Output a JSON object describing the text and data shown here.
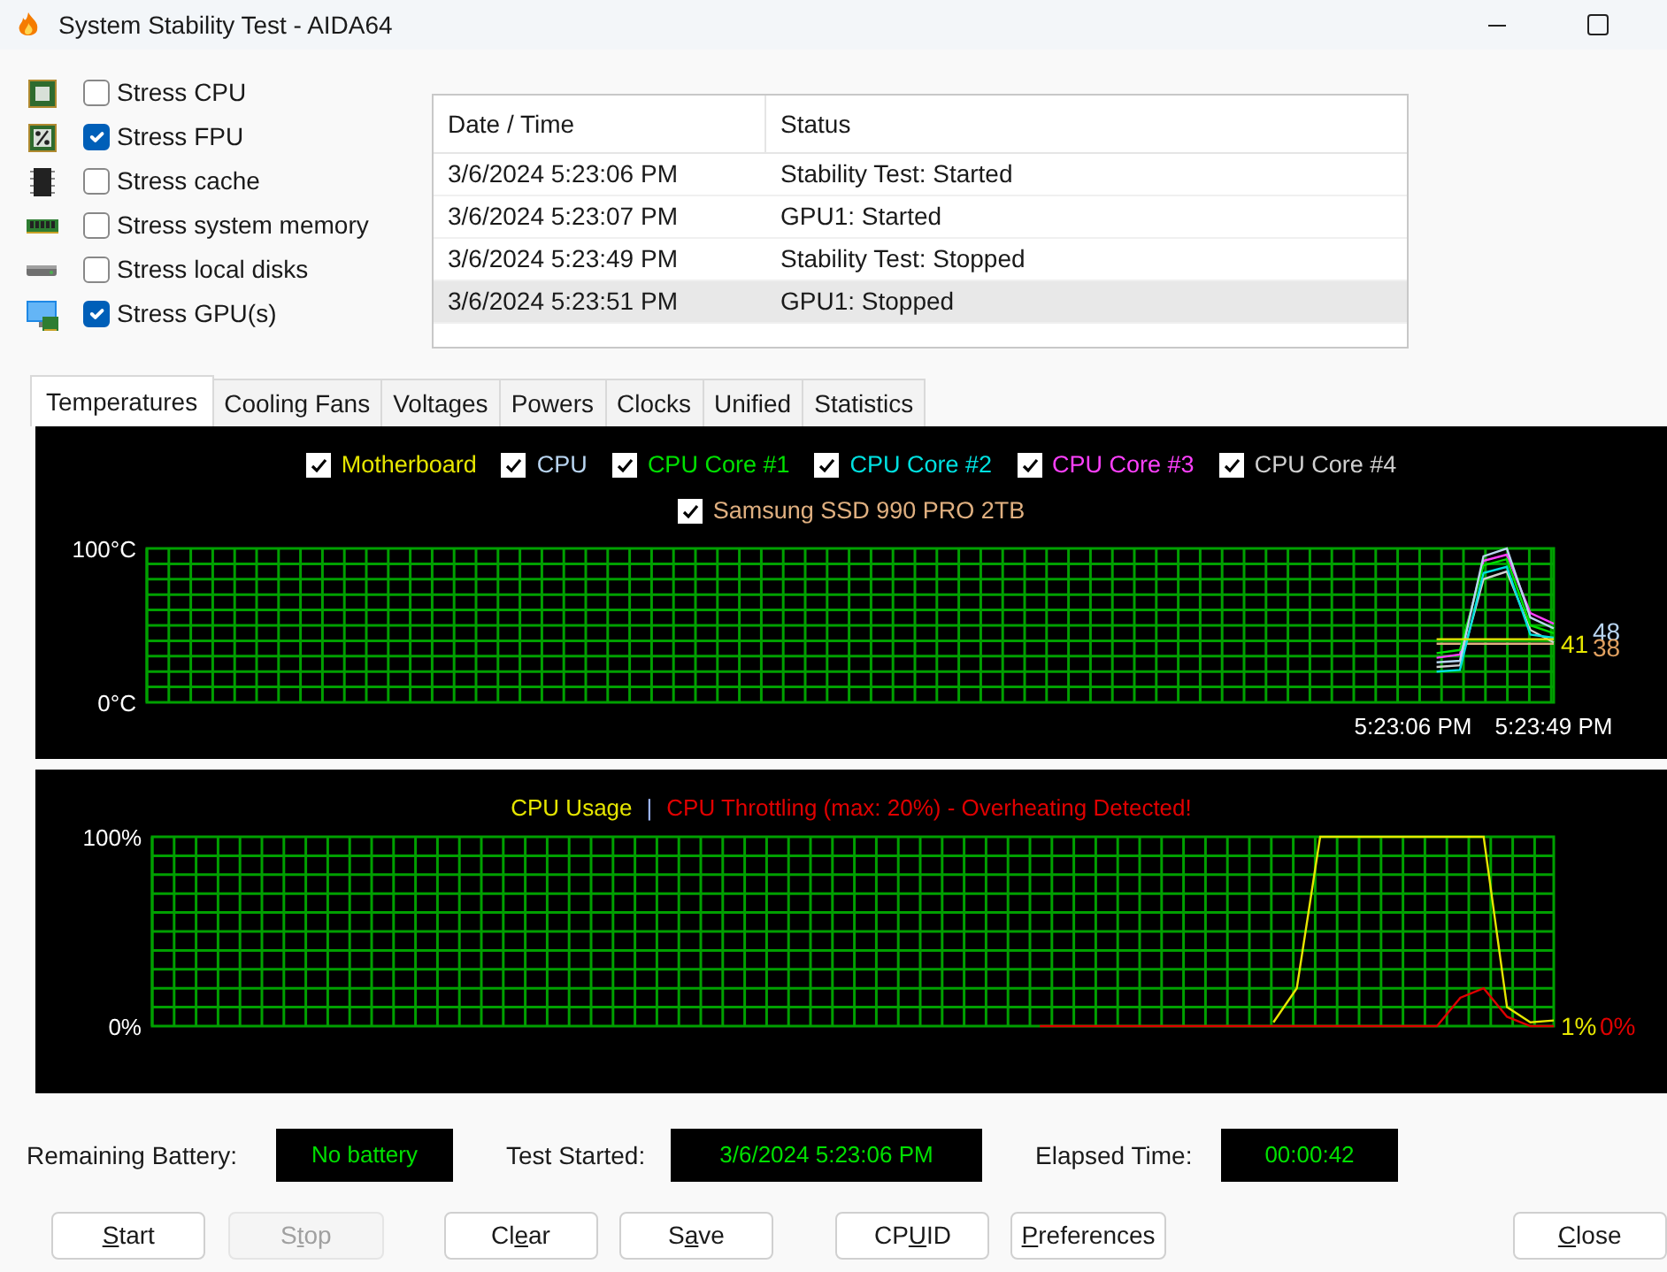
{
  "window": {
    "title": "System Stability Test - AIDA64"
  },
  "stress_options": [
    {
      "label": "Stress CPU",
      "checked": false,
      "kind": "cpu"
    },
    {
      "label": "Stress FPU",
      "checked": true,
      "kind": "fpu"
    },
    {
      "label": "Stress cache",
      "checked": false,
      "kind": "cache"
    },
    {
      "label": "Stress system memory",
      "checked": false,
      "kind": "memory"
    },
    {
      "label": "Stress local disks",
      "checked": false,
      "kind": "disk"
    },
    {
      "label": "Stress GPU(s)",
      "checked": true,
      "kind": "gpu"
    }
  ],
  "log": {
    "columns": [
      "Date / Time",
      "Status"
    ],
    "rows": [
      {
        "cells": [
          "3/6/2024 5:23:06 PM",
          "Stability Test: Started"
        ],
        "selected": false
      },
      {
        "cells": [
          "3/6/2024 5:23:07 PM",
          "GPU1: Started"
        ],
        "selected": false
      },
      {
        "cells": [
          "3/6/2024 5:23:49 PM",
          "Stability Test: Stopped"
        ],
        "selected": false
      },
      {
        "cells": [
          "3/6/2024 5:23:51 PM",
          "GPU1: Stopped"
        ],
        "selected": true
      }
    ]
  },
  "tabs": [
    {
      "label": "Temperatures",
      "selected": true
    },
    {
      "label": "Cooling Fans",
      "selected": false
    },
    {
      "label": "Voltages",
      "selected": false
    },
    {
      "label": "Powers",
      "selected": false
    },
    {
      "label": "Clocks",
      "selected": false
    },
    {
      "label": "Unified",
      "selected": false
    },
    {
      "label": "Statistics",
      "selected": false
    }
  ],
  "temperature_graph": {
    "legend": [
      {
        "checked": true
      },
      {
        "checked": true
      },
      {
        "checked": true
      },
      {
        "checked": true
      },
      {
        "checked": true
      },
      {
        "checked": true
      },
      {
        "checked": true
      }
    ],
    "readings": [
      {
        "text": "41",
        "color": "#e6e600"
      },
      {
        "text": "48",
        "color": "#b8d4f0"
      },
      {
        "text": "38",
        "color": "#e0a060"
      }
    ],
    "chart_data": {
      "type": "line",
      "ylim": [
        0,
        100
      ],
      "grid": true,
      "categories": [
        null,
        null,
        null,
        null,
        null,
        null,
        null,
        null,
        null,
        null,
        null,
        null,
        null,
        null,
        null,
        null,
        null,
        null,
        null,
        null,
        null,
        null,
        null,
        null,
        null,
        null,
        null,
        null,
        null,
        null,
        null,
        null,
        null,
        null,
        null,
        null,
        null,
        null,
        null,
        null,
        null,
        null,
        null,
        null,
        null,
        null,
        null,
        null,
        null,
        null,
        null,
        null,
        null,
        null,
        "5:23:06 PM",
        null,
        null,
        null,
        null,
        null,
        "5:23:49 PM"
      ],
      "yticks": [
        {
          "value": 0,
          "label": "0°C"
        },
        {
          "value": 100,
          "label": "100°C"
        }
      ],
      "series": [
        {
          "name": "Motherboard",
          "color": "#e6e600",
          "values": [
            null,
            null,
            null,
            null,
            null,
            null,
            null,
            null,
            null,
            null,
            null,
            null,
            null,
            null,
            null,
            null,
            null,
            null,
            null,
            null,
            null,
            null,
            null,
            null,
            null,
            null,
            null,
            null,
            null,
            null,
            null,
            null,
            null,
            null,
            null,
            null,
            null,
            null,
            null,
            null,
            null,
            null,
            null,
            null,
            null,
            null,
            null,
            null,
            null,
            null,
            null,
            null,
            null,
            null,
            null,
            41,
            41,
            41,
            41,
            41,
            41
          ]
        },
        {
          "name": "CPU",
          "color": "#b8d4f0",
          "values": [
            null,
            null,
            null,
            null,
            null,
            null,
            null,
            null,
            null,
            null,
            null,
            null,
            null,
            null,
            null,
            null,
            null,
            null,
            null,
            null,
            null,
            null,
            null,
            null,
            null,
            null,
            null,
            null,
            null,
            null,
            null,
            null,
            null,
            null,
            null,
            null,
            null,
            null,
            null,
            null,
            null,
            null,
            null,
            null,
            null,
            null,
            null,
            null,
            null,
            null,
            null,
            null,
            null,
            null,
            null,
            26,
            27,
            95,
            100,
            55,
            48
          ]
        },
        {
          "name": "CPU Core #1",
          "color": "#00e000",
          "values": [
            null,
            null,
            null,
            null,
            null,
            null,
            null,
            null,
            null,
            null,
            null,
            null,
            null,
            null,
            null,
            null,
            null,
            null,
            null,
            null,
            null,
            null,
            null,
            null,
            null,
            null,
            null,
            null,
            null,
            null,
            null,
            null,
            null,
            null,
            null,
            null,
            null,
            null,
            null,
            null,
            null,
            null,
            null,
            null,
            null,
            null,
            null,
            null,
            null,
            null,
            null,
            null,
            null,
            null,
            null,
            32,
            34,
            89,
            93,
            50,
            45
          ]
        },
        {
          "name": "CPU Core #2",
          "color": "#00e0e0",
          "values": [
            null,
            null,
            null,
            null,
            null,
            null,
            null,
            null,
            null,
            null,
            null,
            null,
            null,
            null,
            null,
            null,
            null,
            null,
            null,
            null,
            null,
            null,
            null,
            null,
            null,
            null,
            null,
            null,
            null,
            null,
            null,
            null,
            null,
            null,
            null,
            null,
            null,
            null,
            null,
            null,
            null,
            null,
            null,
            null,
            null,
            null,
            null,
            null,
            null,
            null,
            null,
            null,
            null,
            null,
            null,
            20,
            21,
            84,
            88,
            44,
            42
          ]
        },
        {
          "name": "CPU Core #3",
          "color": "#ff40ff",
          "values": [
            null,
            null,
            null,
            null,
            null,
            null,
            null,
            null,
            null,
            null,
            null,
            null,
            null,
            null,
            null,
            null,
            null,
            null,
            null,
            null,
            null,
            null,
            null,
            null,
            null,
            null,
            null,
            null,
            null,
            null,
            null,
            null,
            null,
            null,
            null,
            null,
            null,
            null,
            null,
            null,
            null,
            null,
            null,
            null,
            null,
            null,
            null,
            null,
            null,
            null,
            null,
            null,
            null,
            null,
            null,
            29,
            31,
            92,
            96,
            58,
            51
          ]
        },
        {
          "name": "CPU Core #4",
          "color": "#d0d0d0",
          "values": [
            null,
            null,
            null,
            null,
            null,
            null,
            null,
            null,
            null,
            null,
            null,
            null,
            null,
            null,
            null,
            null,
            null,
            null,
            null,
            null,
            null,
            null,
            null,
            null,
            null,
            null,
            null,
            null,
            null,
            null,
            null,
            null,
            null,
            null,
            null,
            null,
            null,
            null,
            null,
            null,
            null,
            null,
            null,
            null,
            null,
            null,
            null,
            null,
            null,
            null,
            null,
            null,
            null,
            null,
            null,
            23,
            24,
            80,
            85,
            47,
            39
          ]
        },
        {
          "name": "Samsung SSD 990 PRO 2TB",
          "color": "#e0b080",
          "values": [
            null,
            null,
            null,
            null,
            null,
            null,
            null,
            null,
            null,
            null,
            null,
            null,
            null,
            null,
            null,
            null,
            null,
            null,
            null,
            null,
            null,
            null,
            null,
            null,
            null,
            null,
            null,
            null,
            null,
            null,
            null,
            null,
            null,
            null,
            null,
            null,
            null,
            null,
            null,
            null,
            null,
            null,
            null,
            null,
            null,
            null,
            null,
            null,
            null,
            null,
            null,
            null,
            null,
            null,
            null,
            38,
            38,
            38,
            38,
            38,
            38
          ]
        }
      ]
    }
  },
  "usage_graph": {
    "separator": "|",
    "readings": [
      {
        "text": "1%",
        "color": "#e6e600"
      },
      {
        "text": "0%",
        "color": "#e00000"
      }
    ],
    "chart_data": {
      "type": "line",
      "ylim": [
        0,
        100
      ],
      "grid": true,
      "categories": [
        null,
        null,
        null,
        null,
        null,
        null,
        null,
        null,
        null,
        null,
        null,
        null,
        null,
        null,
        null,
        null,
        null,
        null,
        null,
        null,
        null,
        null,
        null,
        null,
        null,
        null,
        null,
        null,
        null,
        null,
        null,
        null,
        null,
        null,
        null,
        null,
        null,
        null,
        null,
        null,
        null,
        null,
        null,
        null,
        null,
        null,
        null,
        null,
        null,
        null,
        null,
        null,
        null,
        null,
        null,
        null,
        null,
        null,
        null,
        null,
        null
      ],
      "yticks": [
        {
          "value": 0,
          "label": "0%"
        },
        {
          "value": 100,
          "label": "100%"
        }
      ],
      "series": [
        {
          "name": "CPU Usage",
          "color": "#e6e600",
          "values": [
            null,
            null,
            null,
            null,
            null,
            null,
            null,
            null,
            null,
            null,
            null,
            null,
            null,
            null,
            null,
            null,
            null,
            null,
            null,
            null,
            null,
            null,
            null,
            null,
            null,
            null,
            null,
            null,
            null,
            null,
            null,
            null,
            null,
            null,
            null,
            null,
            null,
            null,
            null,
            null,
            null,
            null,
            null,
            null,
            null,
            null,
            null,
            null,
            2,
            20,
            100,
            100,
            100,
            100,
            100,
            100,
            100,
            100,
            10,
            2,
            3
          ]
        },
        {
          "name": "CPU Throttling (max: 20%) - Overheating Detected!",
          "color": "#e00000",
          "values": [
            null,
            null,
            null,
            null,
            null,
            null,
            null,
            null,
            null,
            null,
            null,
            null,
            null,
            null,
            null,
            null,
            null,
            null,
            null,
            null,
            null,
            null,
            null,
            null,
            null,
            null,
            null,
            null,
            null,
            null,
            null,
            null,
            null,
            null,
            null,
            null,
            null,
            null,
            0,
            0,
            0,
            0,
            0,
            0,
            0,
            0,
            0,
            0,
            0,
            0,
            0,
            0,
            0,
            0,
            0,
            0,
            15,
            20,
            5,
            0,
            0
          ]
        }
      ]
    }
  },
  "status": [
    {
      "label": "Remaining Battery:",
      "value": "No battery"
    },
    {
      "label": "Test Started:",
      "value": "3/6/2024 5:23:06 PM"
    },
    {
      "label": "Elapsed Time:",
      "value": "00:00:42"
    }
  ],
  "buttons": [
    {
      "label": {
        "key": "S",
        "after": "tart"
      },
      "disabled": false
    },
    {
      "label": {
        "before": "S",
        "key": "t",
        "after": "op"
      },
      "disabled": true
    },
    {
      "label": {
        "before": "Cl",
        "key": "e",
        "after": "ar"
      },
      "disabled": false
    },
    {
      "label": {
        "before": "S",
        "key": "a",
        "after": "ve"
      },
      "disabled": false
    },
    {
      "label": {
        "before": "CP",
        "key": "U",
        "after": "ID"
      },
      "disabled": false
    },
    {
      "label": {
        "key": "P",
        "after": "references"
      },
      "disabled": false
    },
    {
      "label": {
        "key": "C",
        "after": "lose"
      },
      "disabled": false
    }
  ]
}
